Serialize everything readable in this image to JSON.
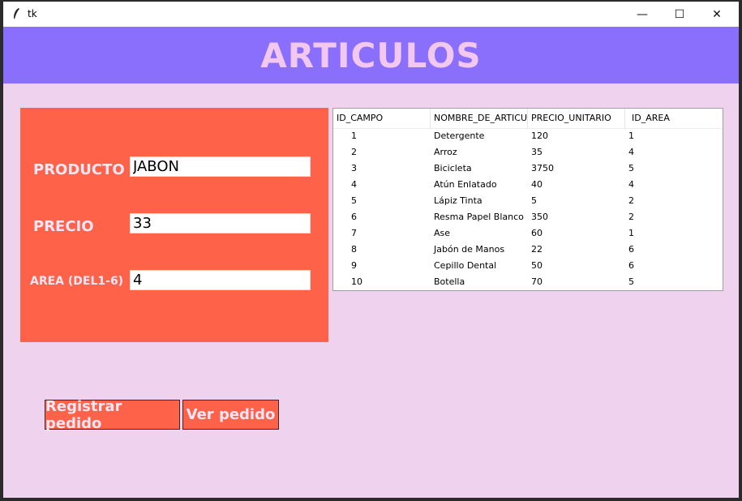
{
  "window": {
    "title": "tk",
    "controls": {
      "minimize": "—",
      "maximize": "☐",
      "close": "✕"
    }
  },
  "header": {
    "title": "ARTICULOS"
  },
  "form": {
    "producto_label": "PRODUCTO",
    "producto_value": "JABON",
    "precio_label": "PRECIO",
    "precio_value": "33",
    "area_label": "AREA (DEL1-6)",
    "area_value": "4"
  },
  "table": {
    "columns": [
      "ID_CAMPO",
      "NOMBRE_DE_ARTICU",
      "PRECIO_UNITARIO",
      "ID_AREA"
    ],
    "rows": [
      [
        "1",
        "Detergente",
        "120",
        "1"
      ],
      [
        "2",
        "Arroz",
        "35",
        "4"
      ],
      [
        "3",
        "Bicicleta",
        "3750",
        "5"
      ],
      [
        "4",
        "Atún Enlatado",
        "40",
        "4"
      ],
      [
        "5",
        "Lápiz Tinta",
        "5",
        "2"
      ],
      [
        "6",
        "Resma Papel Blanco",
        "350",
        "2"
      ],
      [
        "7",
        "Ase",
        "60",
        "1"
      ],
      [
        "8",
        "Jabón de Manos",
        "22",
        "6"
      ],
      [
        "9",
        "Cepillo Dental",
        "50",
        "6"
      ],
      [
        "10",
        "Botella",
        "70",
        "5"
      ]
    ]
  },
  "buttons": {
    "register": "Registrar pedido",
    "view": "Ver pedido"
  },
  "colors": {
    "window_bg": "#efd2ee",
    "header_bg": "#8a6ffc",
    "header_text": "#f2c8f0",
    "panel_bg": "#fe634a",
    "label_text": "#fbe6f5"
  }
}
